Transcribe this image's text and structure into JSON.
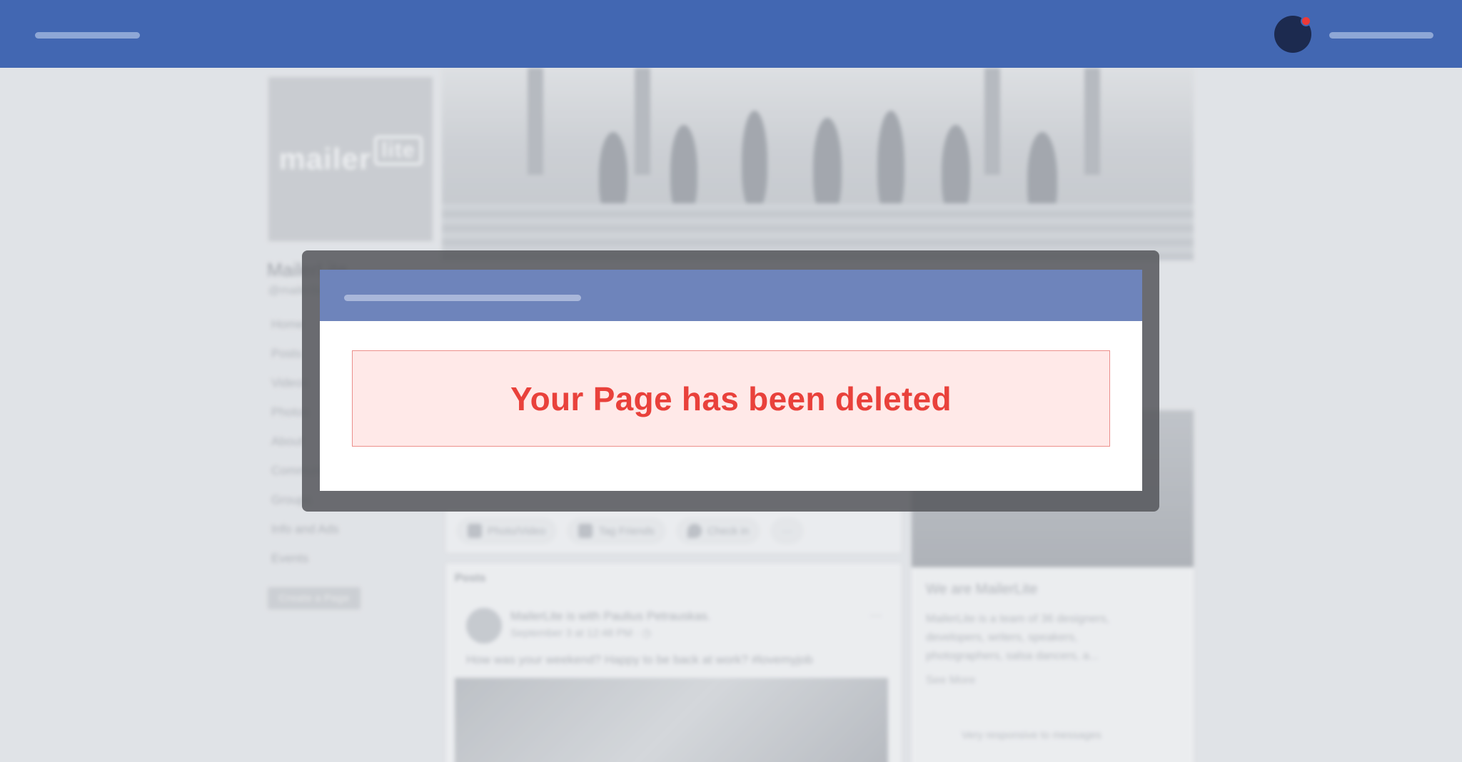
{
  "background": {
    "logo": {
      "word": "mailer",
      "badge": "lite"
    },
    "page_name": "MailerLite",
    "page_handle": "@mailerlite",
    "nav_items": [
      "Home",
      "Posts",
      "Videos",
      "Photos",
      "About",
      "Community",
      "Groups",
      "Info and Ads",
      "Events"
    ],
    "create_page_label": "Create a Page",
    "composer_actions": [
      "Photo/Video",
      "Tag Friends",
      "Check in",
      "···"
    ],
    "posts_title": "Posts",
    "post": {
      "author": "MailerLite is with Paulius Petrauskas.",
      "date": "September 3 at 12:48 PM · ◷",
      "text": "How was your weekend? Happy to be back at work? #lovemyjob",
      "menu": "···"
    },
    "about": {
      "title": "We are MailerLite",
      "text": "MailerLite is a team of 36 designers, developers, writers, speakers, photographers, salsa dancers, a...",
      "see_more": "See More"
    },
    "responsiveness": "Very responsive to messages"
  },
  "modal": {
    "message": "Your Page has been deleted"
  },
  "colors": {
    "topbar": "#4267b2",
    "modal_header": "#6e84bb",
    "alert_background": "#ffe9e8",
    "alert_border": "#ec8f8b",
    "alert_text": "#e9413b",
    "notification_dot": "#ee3a37"
  }
}
